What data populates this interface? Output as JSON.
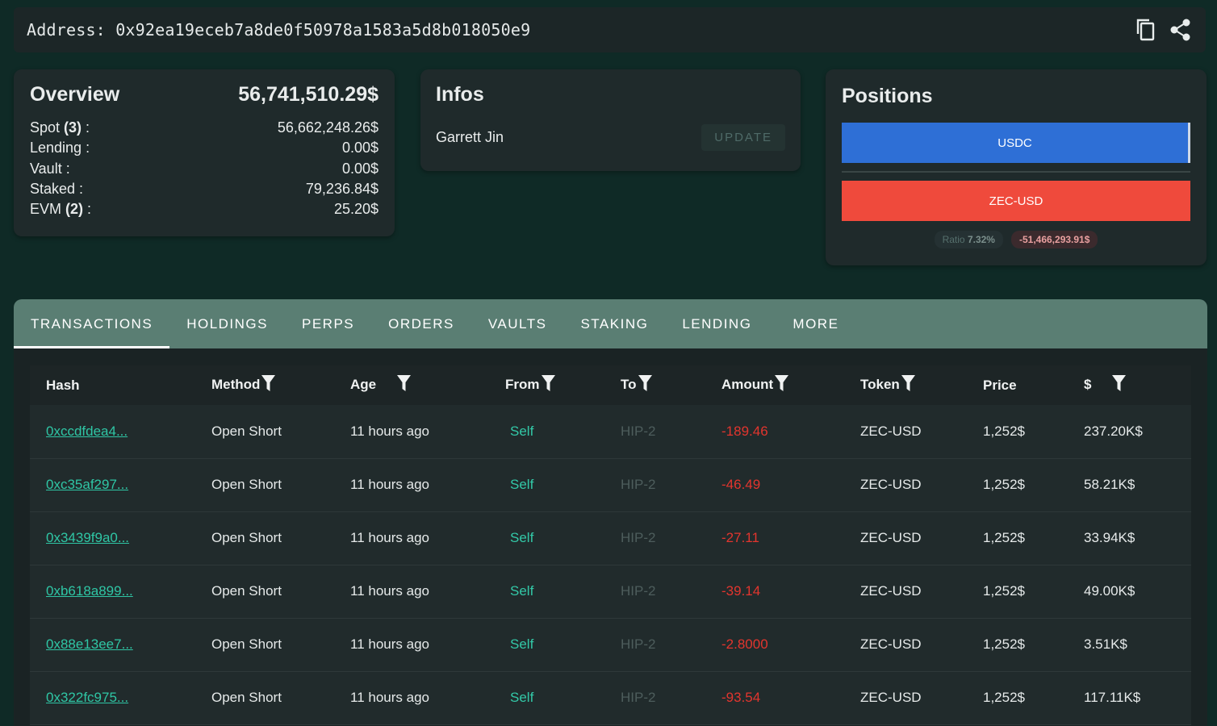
{
  "address": {
    "label": "Address:",
    "value": "0x92ea19eceb7a8de0f50978a1583a5d8b018050e9"
  },
  "overview": {
    "title": "Overview",
    "total": "56,741,510.29$",
    "rows": [
      {
        "label": "Spot",
        "count": "(3)",
        "suffix": " :",
        "value": "56,662,248.26$"
      },
      {
        "label": "Lending :",
        "count": "",
        "suffix": "",
        "value": "0.00$"
      },
      {
        "label": "Vault :",
        "count": "",
        "suffix": "",
        "value": "0.00$"
      },
      {
        "label": "Staked :",
        "count": "",
        "suffix": "",
        "value": "79,236.84$"
      },
      {
        "label": "EVM",
        "count": "(2)",
        "suffix": " :",
        "value": "25.20$"
      }
    ]
  },
  "infos": {
    "title": "Infos",
    "name": "Garrett Jin",
    "update_label": "UPDATE"
  },
  "positions": {
    "title": "Positions",
    "long_label": "USDC",
    "short_label": "ZEC-USD",
    "ratio_label": "Ratio",
    "ratio_value": "7.32%",
    "net_value": "-51,466,293.91$",
    "colors": {
      "long": "#2e6fd6",
      "short": "#ef4a3c"
    }
  },
  "tabs": [
    "TRANSACTIONS",
    "HOLDINGS",
    "PERPS",
    "ORDERS",
    "VAULTS",
    "STAKING",
    "LENDING",
    "MORE"
  ],
  "table": {
    "headers": [
      "Hash",
      "Method",
      "Age",
      "From",
      "To",
      "Amount",
      "Token",
      "Price",
      "$"
    ],
    "rows": [
      {
        "hash": "0xccdfdea4...",
        "method": "Open Short",
        "age": "11 hours ago",
        "from": "Self",
        "to": "HIP-2",
        "amount": "-189.46",
        "token": "ZEC-USD",
        "price": "1,252$",
        "usd": "237.20K$"
      },
      {
        "hash": "0xc35af297...",
        "method": "Open Short",
        "age": "11 hours ago",
        "from": "Self",
        "to": "HIP-2",
        "amount": "-46.49",
        "token": "ZEC-USD",
        "price": "1,252$",
        "usd": "58.21K$"
      },
      {
        "hash": "0x3439f9a0...",
        "method": "Open Short",
        "age": "11 hours ago",
        "from": "Self",
        "to": "HIP-2",
        "amount": "-27.11",
        "token": "ZEC-USD",
        "price": "1,252$",
        "usd": "33.94K$"
      },
      {
        "hash": "0xb618a899...",
        "method": "Open Short",
        "age": "11 hours ago",
        "from": "Self",
        "to": "HIP-2",
        "amount": "-39.14",
        "token": "ZEC-USD",
        "price": "1,252$",
        "usd": "49.00K$"
      },
      {
        "hash": "0x88e13ee7...",
        "method": "Open Short",
        "age": "11 hours ago",
        "from": "Self",
        "to": "HIP-2",
        "amount": "-2.8000",
        "token": "ZEC-USD",
        "price": "1,252$",
        "usd": "3.51K$"
      },
      {
        "hash": "0x322fc975...",
        "method": "Open Short",
        "age": "11 hours ago",
        "from": "Self",
        "to": "HIP-2",
        "amount": "-93.54",
        "token": "ZEC-USD",
        "price": "1,252$",
        "usd": "117.11K$"
      }
    ]
  }
}
